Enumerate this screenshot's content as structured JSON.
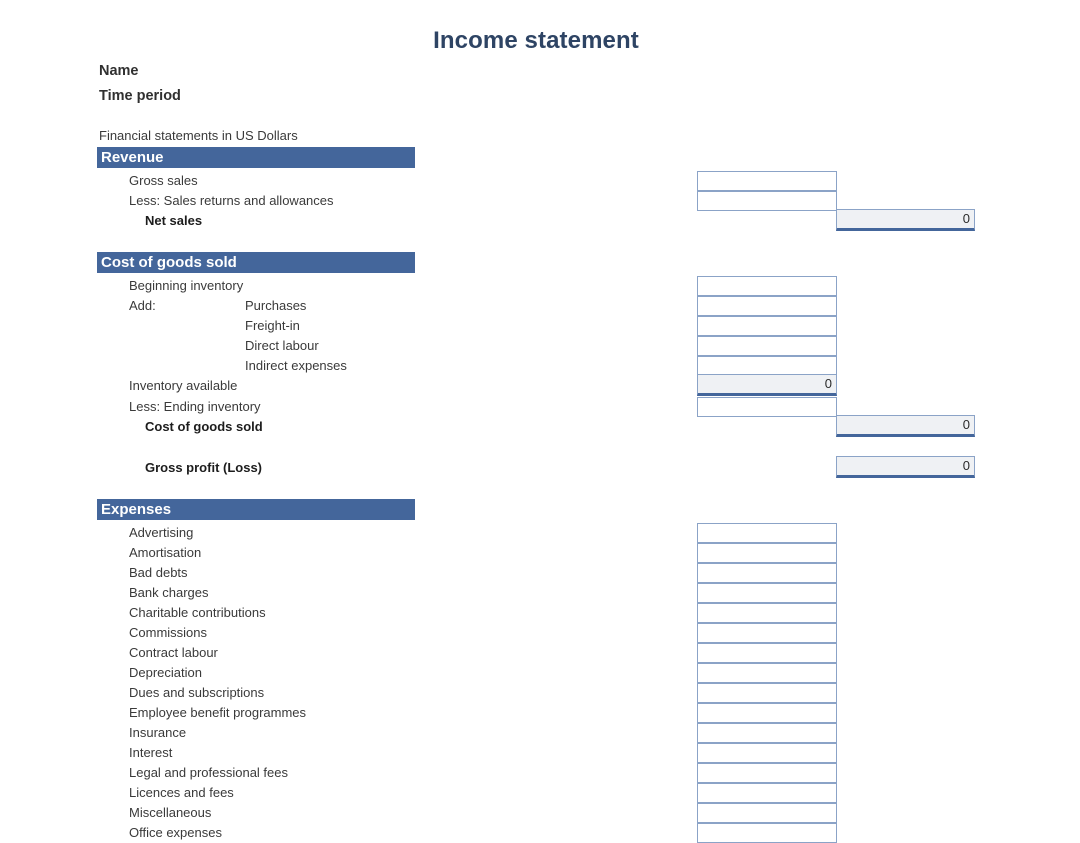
{
  "document": {
    "title": "Income statement",
    "name_label": "Name",
    "time_period_label": "Time period",
    "currency_note": "Financial statements in US Dollars"
  },
  "colors": {
    "title": "#2e4464",
    "section_bar": "#44669b",
    "box_border": "#8ba3c7",
    "total_fill": "#eff1f4",
    "page_background": "#ffffff"
  },
  "sections": {
    "revenue": {
      "heading": "Revenue",
      "rows": [
        {
          "label": "Gross sales",
          "value": "",
          "col": 1,
          "bold": false,
          "indent": "ind1",
          "style": "input"
        },
        {
          "label": "Less: Sales returns and allowances",
          "value": "",
          "col": 1,
          "bold": false,
          "indent": "ind1",
          "style": "input"
        },
        {
          "label": "Net sales",
          "value": "0",
          "col": 2,
          "bold": true,
          "indent": "ind3",
          "style": "total"
        }
      ]
    },
    "cost_of_goods_sold": {
      "heading": "Cost of goods sold",
      "rows": [
        {
          "label": "Beginning inventory",
          "value": "",
          "col": 1,
          "bold": false,
          "indent": "ind0",
          "style": "input"
        },
        {
          "label": "Add:",
          "label2": "Purchases",
          "value": "",
          "col": 1,
          "bold": false,
          "indent": "indA",
          "style": "input"
        },
        {
          "label": "Freight-in",
          "value": "",
          "col": 1,
          "bold": false,
          "indent": "ind2",
          "style": "input"
        },
        {
          "label": "Direct labour",
          "value": "",
          "col": 1,
          "bold": false,
          "indent": "ind2",
          "style": "input"
        },
        {
          "label": "Indirect expenses",
          "value": "",
          "col": 1,
          "bold": false,
          "indent": "ind2",
          "style": "input"
        },
        {
          "label": "Inventory available",
          "value": "0",
          "col": 1,
          "bold": false,
          "indent": "ind0",
          "style": "subtotal"
        },
        {
          "label": "Less: Ending inventory",
          "value": "",
          "col": 1,
          "bold": false,
          "indent": "ind0",
          "style": "input"
        },
        {
          "label": "Cost of goods sold",
          "value": "0",
          "col": 2,
          "bold": true,
          "indent": "ind3",
          "style": "total"
        }
      ]
    },
    "gross_profit": {
      "label": "Gross profit (Loss)",
      "value": "0"
    },
    "expenses": {
      "heading": "Expenses",
      "rows": [
        {
          "label": "Advertising"
        },
        {
          "label": "Amortisation"
        },
        {
          "label": "Bad debts"
        },
        {
          "label": "Bank charges"
        },
        {
          "label": "Charitable contributions"
        },
        {
          "label": "Commissions"
        },
        {
          "label": "Contract labour"
        },
        {
          "label": "Depreciation"
        },
        {
          "label": "Dues and subscriptions"
        },
        {
          "label": "Employee benefit programmes"
        },
        {
          "label": "Insurance"
        },
        {
          "label": "Interest"
        },
        {
          "label": "Legal and professional fees"
        },
        {
          "label": "Licences and fees"
        },
        {
          "label": "Miscellaneous"
        },
        {
          "label": "Office expenses"
        }
      ]
    }
  }
}
